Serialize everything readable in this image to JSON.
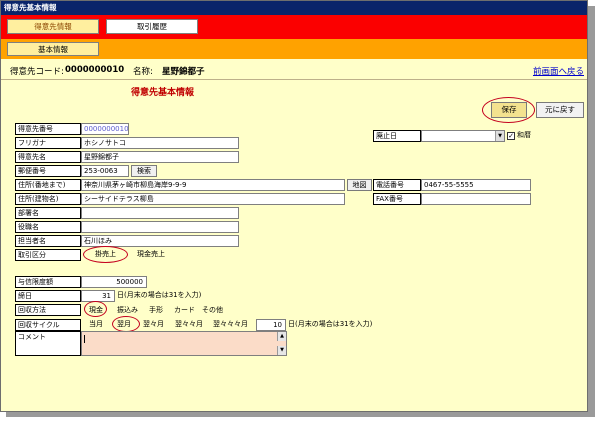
{
  "window": {
    "title": "得意先基本情報"
  },
  "tabs": [
    {
      "label": "得意先情報",
      "active": true
    },
    {
      "label": "取引履歴",
      "active": false
    }
  ],
  "subtab": {
    "label": "基本情報"
  },
  "header": {
    "code_label": "得意先コード:",
    "code_value": "0000000010",
    "name_label": "名称:",
    "name_value": "星野錦都子",
    "back_link": "前画面へ戻る"
  },
  "section_title": "得意先基本情報",
  "buttons": {
    "save": "保存",
    "return": "元に戻す",
    "search": "検索",
    "map": "地図"
  },
  "fields": {
    "customer_no": {
      "label": "得意先番号",
      "value": "0000000010"
    },
    "furigana": {
      "label": "フリガナ",
      "value": "ホシノサトコ"
    },
    "customer_name": {
      "label": "得意先名",
      "value": "星野錦都子"
    },
    "postal": {
      "label": "郵便番号",
      "value": "253-0063"
    },
    "address1": {
      "label": "住所(番地まで)",
      "value": "神奈川県茅ヶ崎市柳島海岸9-9-9"
    },
    "address2": {
      "label": "住所(建物名)",
      "value": "シーサイドテラス柳島"
    },
    "department": {
      "label": "部署名",
      "value": ""
    },
    "position": {
      "label": "役職名",
      "value": ""
    },
    "contact": {
      "label": "担当者名",
      "value": "石川ほみ"
    },
    "trade_type": {
      "label": "取引区分",
      "options": [
        "掛売上",
        "現金売上"
      ],
      "selected": "掛売上"
    },
    "credit_limit": {
      "label": "与信限度額",
      "value": "500000"
    },
    "closing_day": {
      "label": "締日",
      "value": "31",
      "suffix": "日(月末の場合は31を入力)"
    },
    "collection_method": {
      "label": "回収方法",
      "options": [
        "現金",
        "振込み",
        "手形",
        "カード",
        "その他"
      ],
      "selected": "現金"
    },
    "collection_cycle": {
      "label": "回収サイクル",
      "options": [
        "当月",
        "翌月",
        "翌々月",
        "翌々々月",
        "翌々々々月"
      ],
      "selected": "翌月",
      "day_value": "10",
      "day_suffix": "日(月末の場合は31を入力)"
    },
    "comment": {
      "label": "コメント",
      "value": ""
    },
    "abolish_date": {
      "label": "廃止日",
      "value": ""
    },
    "wareki": {
      "label": "和暦",
      "checked": true
    },
    "phone": {
      "label": "電話番号",
      "value": "0467-55-5555"
    },
    "fax": {
      "label": "FAX番号",
      "value": ""
    }
  },
  "colors": {
    "tabbar": "#fb0000",
    "subbar": "#ffa200",
    "background": "#ffffc9",
    "highlight_circle": "#c4001e",
    "comment_bg": "#fbdcc8"
  }
}
